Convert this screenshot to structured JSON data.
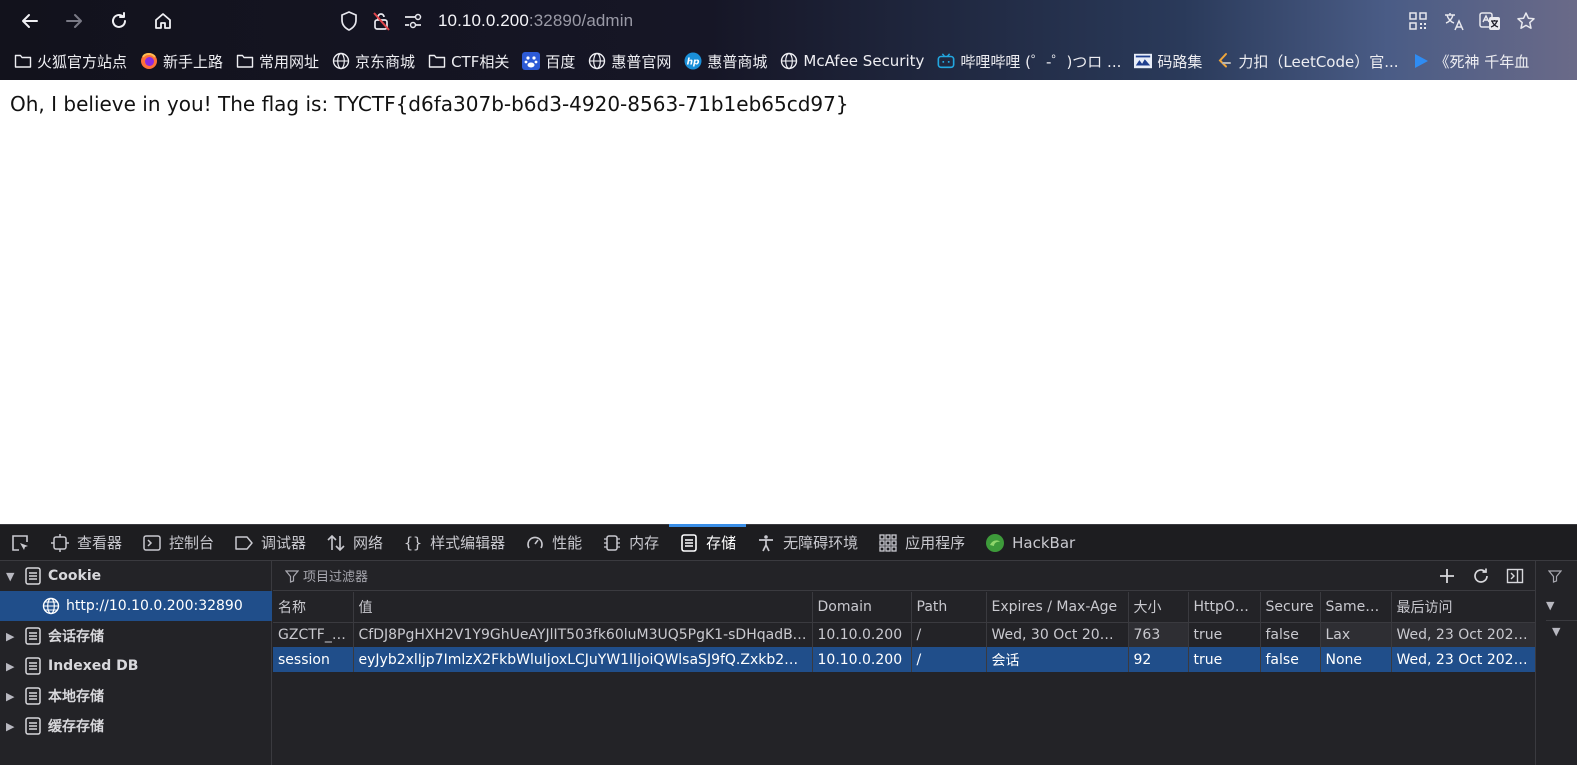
{
  "browser": {
    "url_host": "10.10.0.200",
    "url_rest": ":32890/admin",
    "bookmarks": [
      {
        "label": "火狐官方站点",
        "icon": "folder-icon"
      },
      {
        "label": "新手上路",
        "icon": "firefox-icon"
      },
      {
        "label": "常用网址",
        "icon": "folder-icon"
      },
      {
        "label": "京东商城",
        "icon": "globe-icon"
      },
      {
        "label": "CTF相关",
        "icon": "folder-icon"
      },
      {
        "label": "百度",
        "icon": "baidu-icon"
      },
      {
        "label": "惠普官网",
        "icon": "globe-icon"
      },
      {
        "label": "惠普商城",
        "icon": "hp-icon"
      },
      {
        "label": "McAfee Security",
        "icon": "globe-icon"
      },
      {
        "label": "哔哩哔哩 (゜-゜)つロ ...",
        "icon": "bilibili-icon"
      },
      {
        "label": "码路集",
        "icon": "site-icon"
      },
      {
        "label": "力扣（LeetCode）官...",
        "icon": "leetcode-icon"
      },
      {
        "label": "《死神 千年血",
        "icon": "play-icon"
      }
    ]
  },
  "page": {
    "flag_text": "Oh, I believe in you! The flag is: TYCTF{d6fa307b-b6d3-4920-8563-71b1eb65cd97}"
  },
  "devtools": {
    "tabs": [
      {
        "label": "查看器",
        "icon": "inspector-icon"
      },
      {
        "label": "控制台",
        "icon": "console-icon"
      },
      {
        "label": "调试器",
        "icon": "debugger-icon"
      },
      {
        "label": "网络",
        "icon": "network-icon"
      },
      {
        "label": "样式编辑器",
        "icon": "style-editor-icon"
      },
      {
        "label": "性能",
        "icon": "performance-icon"
      },
      {
        "label": "内存",
        "icon": "memory-icon"
      },
      {
        "label": "存储",
        "icon": "storage-icon"
      },
      {
        "label": "无障碍环境",
        "icon": "accessibility-icon"
      },
      {
        "label": "应用程序",
        "icon": "application-icon"
      },
      {
        "label": "HackBar",
        "icon": "hackbar-icon"
      }
    ],
    "sidebar": {
      "cookie": "Cookie",
      "cookie_host": "http://10.10.0.200:32890",
      "session_storage": "会话存储",
      "indexed_db": "Indexed DB",
      "local_storage": "本地存储",
      "cache_storage": "缓存存储"
    },
    "filter_placeholder": "项目过滤器",
    "columns": [
      "名称",
      "值",
      "Domain",
      "Path",
      "Expires / Max-Age",
      "大小",
      "HttpOnly",
      "Secure",
      "SameSite",
      "最后访问"
    ],
    "rows": [
      [
        "GZCTF_T...",
        "CfDJ8PgHXH2V1Y9GhUeAYJlIT503fk60luM3UQ5PgK1-sDHqadBS9...",
        "10.10.0.200",
        "/",
        "Wed, 30 Oct 2024 ...",
        "763",
        "true",
        "false",
        "Lax",
        "Wed, 23 Oct 2024 ..."
      ],
      [
        "session",
        "eyJyb2xlIjp7ImlzX2FkbWluIjoxLCJuYW1lIjoiQWlsaSJ9fQ.Zxkb2g.d-b...",
        "10.10.0.200",
        "/",
        "会话",
        "92",
        "true",
        "false",
        "None",
        "Wed, 23 Oct 2024 ..."
      ]
    ]
  },
  "colors": {
    "devtools_bg": "#232327",
    "selection": "#204e8a",
    "active_tab_accent": "#3a8ee6"
  }
}
